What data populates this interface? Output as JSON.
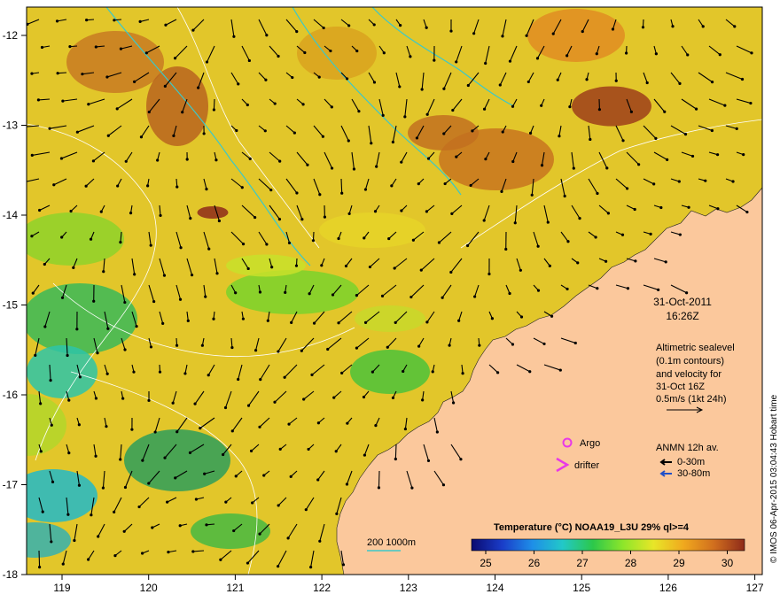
{
  "axes": {
    "x_ticks": [
      "119",
      "120",
      "121",
      "122",
      "123",
      "124",
      "125",
      "126",
      "127"
    ],
    "y_ticks": [
      "-12",
      "-13",
      "-14",
      "-15",
      "-16",
      "-17",
      "-18"
    ]
  },
  "datetime": {
    "date": "31-Oct-2011",
    "time": "16:26Z"
  },
  "altimetry_note": {
    "lines": [
      "Altimetric sealevel",
      "(0.1m contours)",
      "and velocity for",
      "31-Oct 16Z",
      "0.5m/s (1kt 24h)"
    ]
  },
  "legend": {
    "argo_label": "Argo",
    "drifter_label": "drifter",
    "anmn_title": "ANMN 12h av.",
    "anmn_shallow": "0-30m",
    "anmn_deep": "30-80m"
  },
  "isobath_label": "200  1000m",
  "colorbar": {
    "title": "Temperature (°C) NOAA19_L3U 29% ql>=4",
    "ticks": [
      "25",
      "26",
      "27",
      "28",
      "29",
      "30"
    ],
    "colors": [
      "#0a0a70",
      "#1a3cc8",
      "#1e8ee8",
      "#22c8c8",
      "#2cc84a",
      "#8ee62a",
      "#e8e628",
      "#f0a81e",
      "#d06e1e",
      "#8e2a1a"
    ]
  },
  "credit": "© IMOS 06-Apr-2015 03:04:43 Hobart time",
  "colors": {
    "land": "#fbc89c",
    "frame": "#000000",
    "isobath": "#3cc8c8",
    "contour": "#ffffff",
    "argo": "#e838e8",
    "anmn_shallow": "#000000",
    "anmn_deep": "#2050c8"
  }
}
